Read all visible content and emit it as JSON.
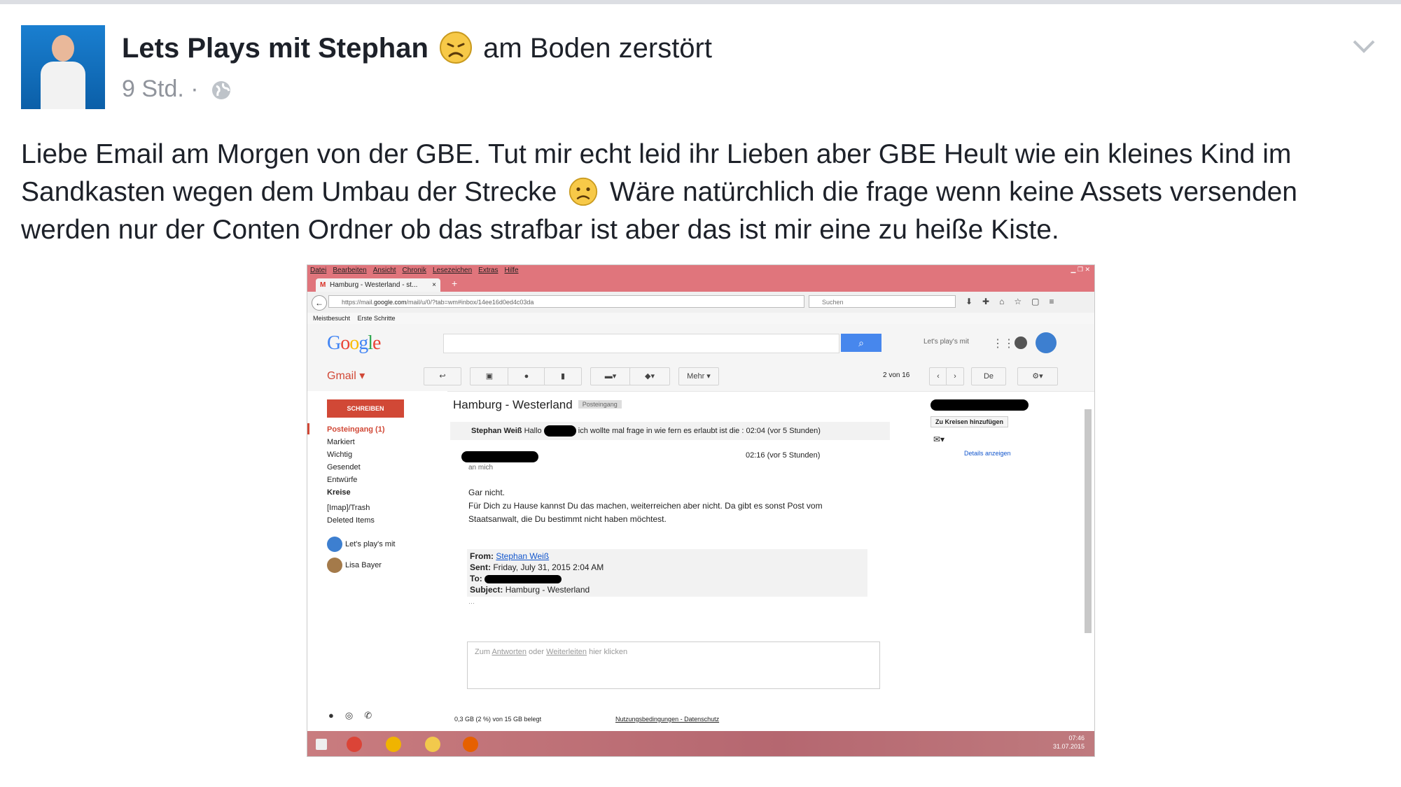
{
  "post": {
    "author": "Lets Plays mit Stephan",
    "feeling": "am Boden zerstört",
    "time": "9 Std.",
    "separator": "·",
    "text_part1": "Liebe Email am Morgen von der GBE. Tut mir echt leid ihr Lieben aber GBE Heult wie ein kleines Kind im Sandkasten wegen dem Umbau der Strecke",
    "text_part2": "Wäre natürchlich die frage wenn keine Assets versenden werden nur der Conten Ordner ob das strafbar ist aber das ist mir eine zu heiße Kiste."
  },
  "icons": {
    "feeling": "sad-face-emoji",
    "inline": "frown-face-emoji",
    "privacy": "globe-icon",
    "menu": "chevron-down-icon"
  },
  "screenshot": {
    "menu": [
      "Datei",
      "Bearbeiten",
      "Ansicht",
      "Chronik",
      "Lesezeichen",
      "Extras",
      "Hilfe"
    ],
    "tab_title": "Hamburg - Westerland - st...",
    "url_prefix": "https://mail.",
    "url_domain": "google.com",
    "url_rest": "/mail/u/0/?tab=wm#inbox/14ee16d0ed4c03da",
    "search_placeholder": "Suchen",
    "bookmarks": [
      "Meistbesucht",
      "Erste Schritte"
    ],
    "google_logo": "Google",
    "account_name": "Let's play's mit",
    "gmail_label": "Gmail ▾",
    "more_button": "Mehr ▾",
    "pager_text": "2 von 16",
    "lang_button": "De",
    "compose": "SCHREIBEN",
    "nav": [
      "Posteingang (1)",
      "Markiert",
      "Wichtig",
      "Gesendet",
      "Entwürfe",
      "Kreise",
      "[Imap]/Trash",
      "Deleted Items"
    ],
    "contacts": [
      "Let's play's mit",
      "Lisa Bayer"
    ],
    "subject": "Hamburg - Westerland",
    "subject_label": "Posteingang",
    "sender": "Stephan Weiß",
    "snippet_start": "Hallo",
    "snippet_end": "ich wollte mal frage in wie fern es erlaubt ist die :",
    "snippet_time": "02:04 (vor 5 Stunden)",
    "reply_time": "02:16 (vor 5 Stunden)",
    "to_me": "an mich",
    "body_line1": "Gar nicht.",
    "body_line2": "Für Dich zu Hause kannst Du das machen, weiterreichen aber nicht. Da gibt es sonst Post vom Staatsanwalt, die Du bestimmt nicht haben möchtest.",
    "from_label": "From:",
    "from_value": "Stephan Weiß",
    "sent_label": "Sent:",
    "sent_value": "Friday, July 31, 2015 2:04 AM",
    "to_label": "To:",
    "subject_label2": "Subject:",
    "subject_value": "Hamburg - Westerland",
    "ellipsis_button": "···",
    "reply_prefix": "Zum",
    "reply_link1": "Antworten",
    "reply_mid": "oder",
    "reply_link2": "Weiterleiten",
    "reply_suffix": "hier klicken",
    "add_circles": "Zu Kreisen hinzufügen",
    "details": "Details anzeigen",
    "quota": "0,3 GB (2 %) von 15 GB belegt",
    "terms": "Nutzungsbedingungen - Datenschutz",
    "clock_time": "07:46",
    "clock_date": "31.07.2015"
  },
  "colors": {
    "firefox_chrome": "#e0757c",
    "gmail_red": "#d14836",
    "search_blue": "#4787ed",
    "meta_grey": "#90949c"
  }
}
